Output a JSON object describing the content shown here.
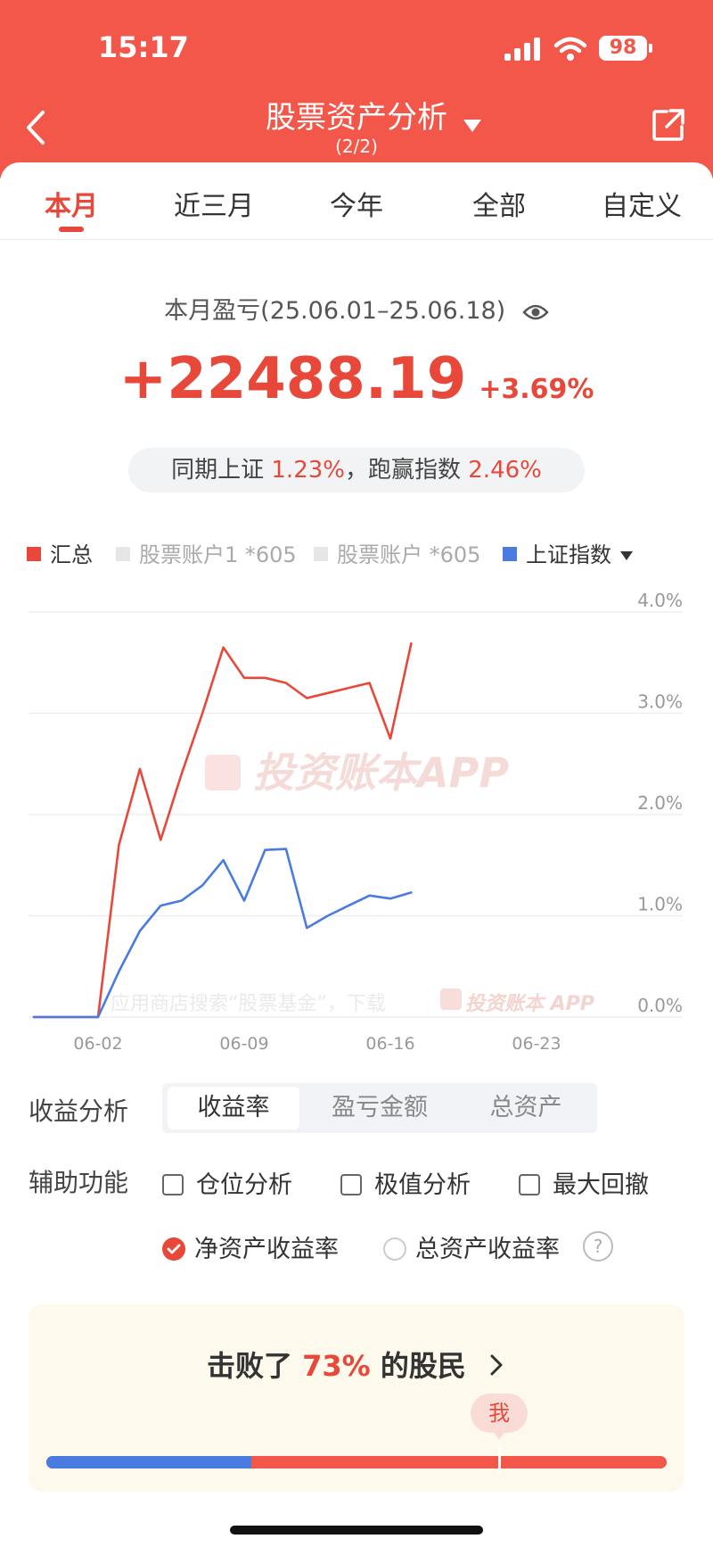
{
  "status_bar": {
    "time": "15:17",
    "battery": "98"
  },
  "nav": {
    "title": "股票资产分析",
    "subtitle": "(2/2)"
  },
  "tabs": [
    {
      "label": "本月",
      "active": true
    },
    {
      "label": "近三月",
      "active": false
    },
    {
      "label": "今年",
      "active": false
    },
    {
      "label": "全部",
      "active": false
    },
    {
      "label": "自定义",
      "active": false
    }
  ],
  "summary": {
    "label": "本月盈亏(25.06.01–25.06.18)",
    "value": "+22488.19",
    "percent": "+3.69%",
    "compare_prefix": "同期上证 ",
    "compare_index": "1.23%",
    "compare_mid": "，跑赢指数 ",
    "compare_beat": "2.46%"
  },
  "legend": [
    {
      "label": "汇总",
      "color": "#e8483a",
      "active": true
    },
    {
      "label": "股票账户1 *605",
      "color": "#e6e6e6",
      "active": false
    },
    {
      "label": "股票账户 *605",
      "color": "#e6e6e6",
      "active": false
    },
    {
      "label": "上证指数",
      "color": "#4a7be0",
      "active": true
    }
  ],
  "chart_data": {
    "type": "line",
    "y_ticks": [
      "4.0%",
      "3.0%",
      "2.0%",
      "1.0%",
      "0.0%"
    ],
    "x_ticks": [
      "06-02",
      "06-09",
      "06-16",
      "06-23"
    ],
    "ylim": [
      0,
      4
    ],
    "watermark": "投资账本APP",
    "watermark_bottom": "应用商店搜索“股票基金”，下载",
    "watermark_bottom_brand": "投资账本 APP",
    "series": [
      {
        "name": "汇总",
        "color": "#e8483a",
        "points": [
          {
            "x": "05-30",
            "y": 0
          },
          {
            "x": "06-02",
            "y": 0
          },
          {
            "x": "06-03",
            "y": 1.7
          },
          {
            "x": "06-04",
            "y": 2.45
          },
          {
            "x": "06-05",
            "y": 1.75
          },
          {
            "x": "06-06",
            "y": 2.4
          },
          {
            "x": "06-07",
            "y": 3.0
          },
          {
            "x": "06-08",
            "y": 3.65
          },
          {
            "x": "06-09",
            "y": 3.35
          },
          {
            "x": "06-10",
            "y": 3.35
          },
          {
            "x": "06-11",
            "y": 3.3
          },
          {
            "x": "06-12",
            "y": 3.15
          },
          {
            "x": "06-13",
            "y": 3.2
          },
          {
            "x": "06-14",
            "y": 3.25
          },
          {
            "x": "06-15",
            "y": 3.3
          },
          {
            "x": "06-16",
            "y": 2.75
          },
          {
            "x": "06-17",
            "y": 3.69
          }
        ]
      },
      {
        "name": "上证指数",
        "color": "#4a7be0",
        "points": [
          {
            "x": "05-30",
            "y": 0
          },
          {
            "x": "06-02",
            "y": 0
          },
          {
            "x": "06-03",
            "y": 0.45
          },
          {
            "x": "06-04",
            "y": 0.85
          },
          {
            "x": "06-05",
            "y": 1.1
          },
          {
            "x": "06-06",
            "y": 1.15
          },
          {
            "x": "06-07",
            "y": 1.3
          },
          {
            "x": "06-08",
            "y": 1.55
          },
          {
            "x": "06-09",
            "y": 1.15
          },
          {
            "x": "06-10",
            "y": 1.65
          },
          {
            "x": "06-11",
            "y": 1.66
          },
          {
            "x": "06-12",
            "y": 0.88
          },
          {
            "x": "06-13",
            "y": 1.0
          },
          {
            "x": "06-14",
            "y": 1.1
          },
          {
            "x": "06-15",
            "y": 1.2
          },
          {
            "x": "06-16",
            "y": 1.17
          },
          {
            "x": "06-17",
            "y": 1.23
          }
        ]
      }
    ]
  },
  "analysis": {
    "label": "收益分析",
    "options": [
      {
        "label": "收益率",
        "active": true
      },
      {
        "label": "盈亏金额",
        "active": false
      },
      {
        "label": "总资产",
        "active": false
      }
    ]
  },
  "aux": {
    "label": "辅助功能",
    "checkboxes": [
      "仓位分析",
      "极值分析",
      "最大回撤"
    ],
    "radios": [
      {
        "label": "净资产收益率",
        "selected": true
      },
      {
        "label": "总资产收益率",
        "selected": false
      }
    ],
    "help": "?"
  },
  "beat": {
    "prefix": "击败了 ",
    "percent": "73%",
    "suffix": " 的股民",
    "marker": "我",
    "position": 0.73,
    "blue_fraction": 0.33
  }
}
